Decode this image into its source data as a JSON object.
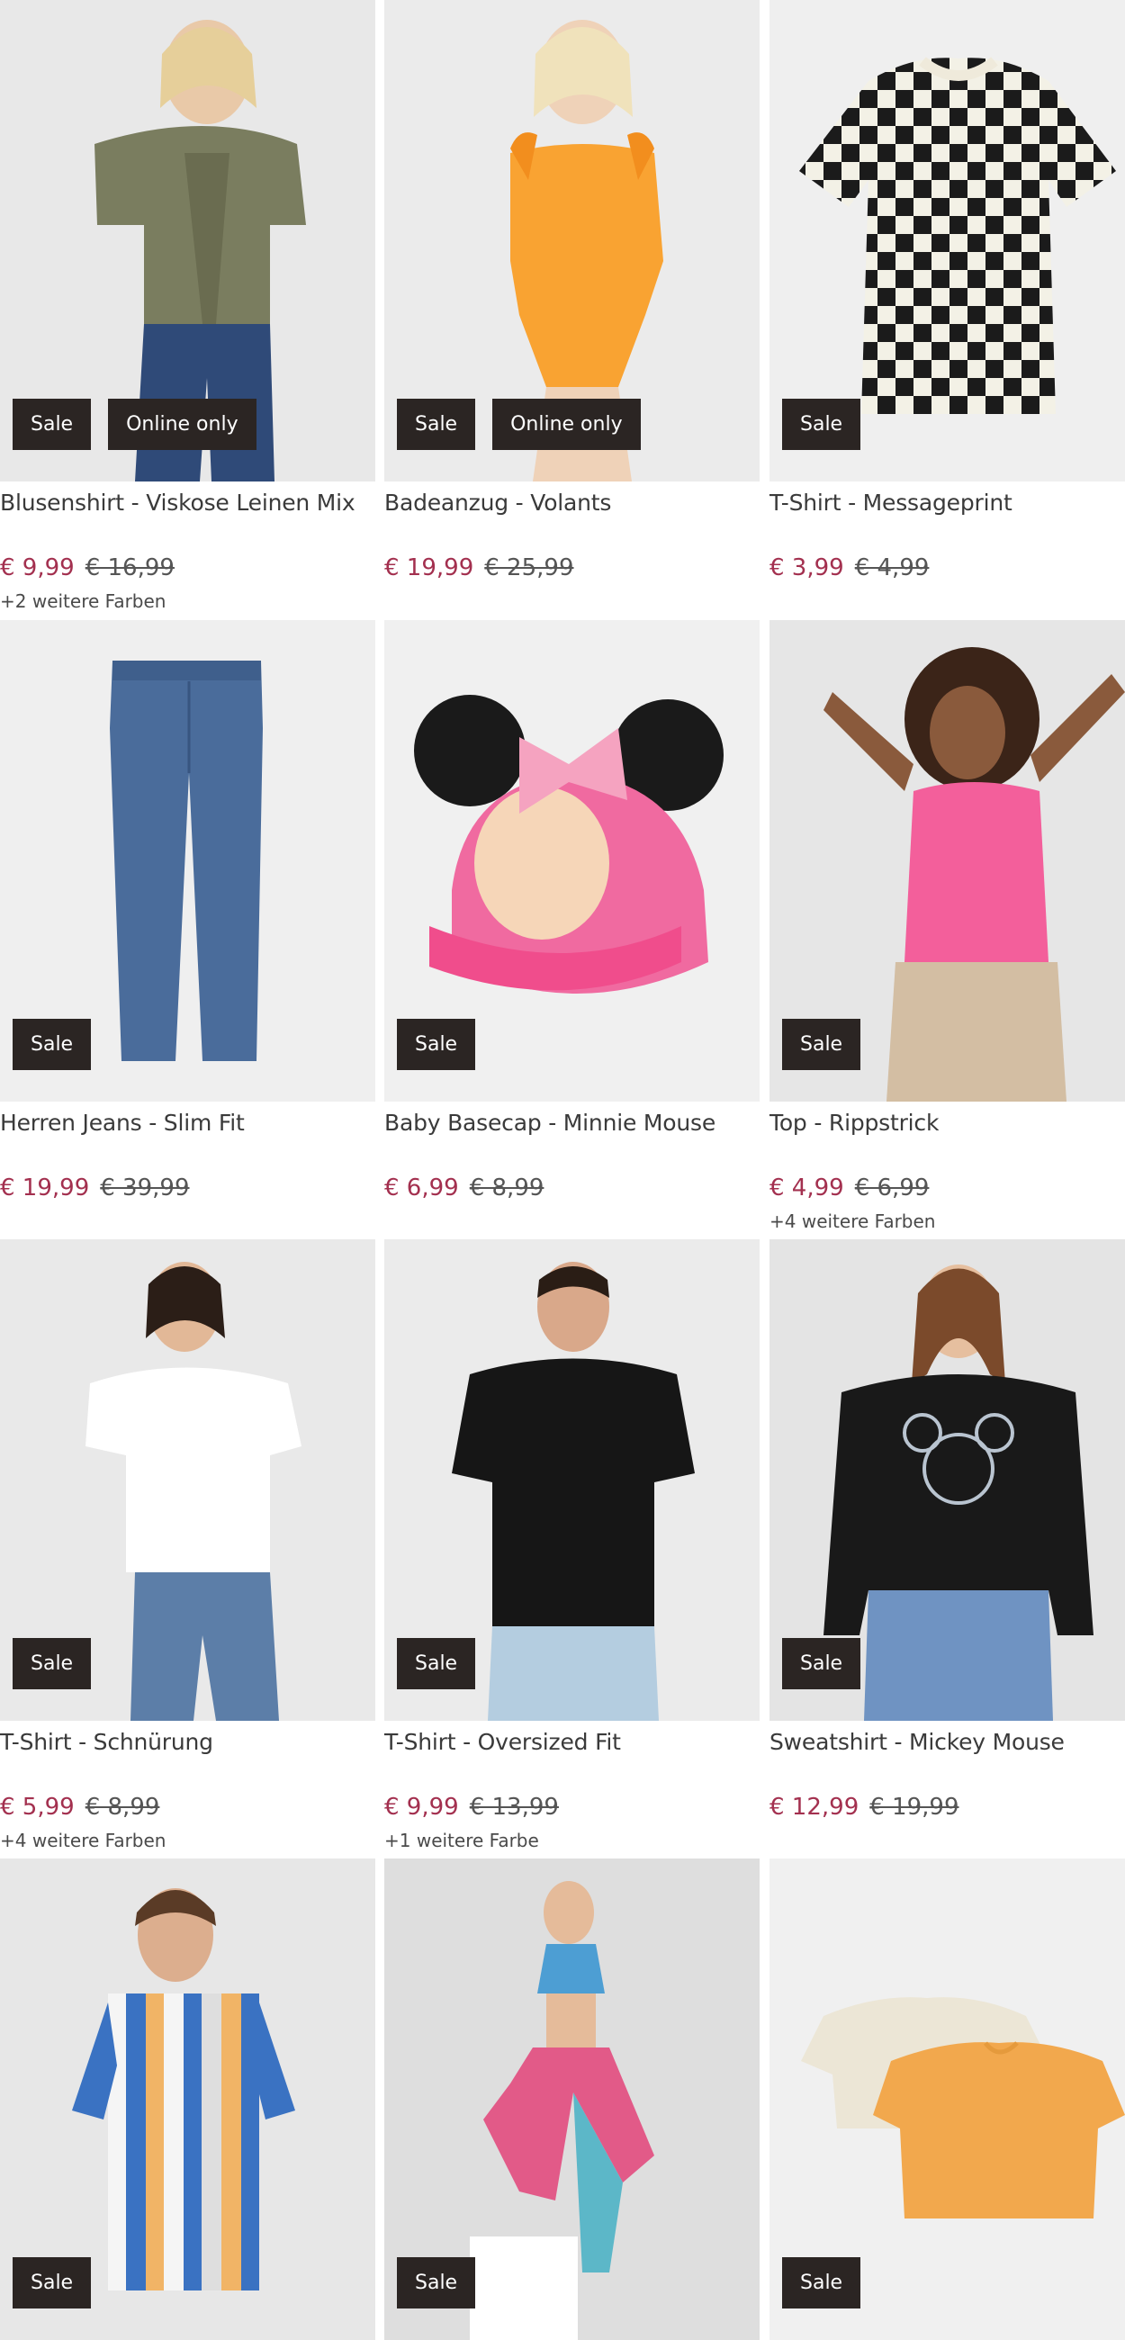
{
  "badges": {
    "sale": "Sale",
    "online": "Online only"
  },
  "products": [
    {
      "title": "Blusenshirt - Viskose Leinen Mix",
      "price": "€ 9,99",
      "old_price": "€ 16,99",
      "colors": "+2 weitere Farben",
      "badges": [
        "Sale",
        "Online only"
      ]
    },
    {
      "title": "Badeanzug - Volants",
      "price": "€ 19,99",
      "old_price": "€ 25,99",
      "colors": "",
      "badges": [
        "Sale",
        "Online only"
      ]
    },
    {
      "title": "T-Shirt - Messageprint",
      "price": "€ 3,99",
      "old_price": "€ 4,99",
      "colors": "",
      "badges": [
        "Sale"
      ]
    },
    {
      "title": "Herren Jeans - Slim Fit",
      "price": "€ 19,99",
      "old_price": "€ 39,99",
      "colors": "",
      "badges": [
        "Sale"
      ]
    },
    {
      "title": "Baby Basecap - Minnie Mouse",
      "price": "€ 6,99",
      "old_price": "€ 8,99",
      "colors": "",
      "badges": [
        "Sale"
      ]
    },
    {
      "title": "Top - Rippstrick",
      "price": "€ 4,99",
      "old_price": "€ 6,99",
      "colors": "+4 weitere Farben",
      "badges": [
        "Sale"
      ]
    },
    {
      "title": "T-Shirt - Schnürung",
      "price": "€ 5,99",
      "old_price": "€ 8,99",
      "colors": "+4 weitere Farben",
      "badges": [
        "Sale"
      ]
    },
    {
      "title": "T-Shirt - Oversized Fit",
      "price": "€ 9,99",
      "old_price": "€ 13,99",
      "colors": "+1 weitere Farbe",
      "badges": [
        "Sale"
      ]
    },
    {
      "title": "Sweatshirt - Mickey Mouse",
      "price": "€ 12,99",
      "old_price": "€ 19,99",
      "colors": "",
      "badges": [
        "Sale"
      ]
    },
    {
      "title": "",
      "price": "",
      "old_price": "",
      "colors": "",
      "badges": [
        "Sale"
      ]
    },
    {
      "title": "",
      "price": "",
      "old_price": "",
      "colors": "",
      "badges": [
        "Sale"
      ]
    },
    {
      "title": "",
      "price": "",
      "old_price": "",
      "colors": "",
      "badges": [
        "Sale"
      ]
    }
  ],
  "colors": {
    "price": "#a3304f",
    "badge_bg": "#2b2523",
    "image_bg": "#ececec"
  }
}
